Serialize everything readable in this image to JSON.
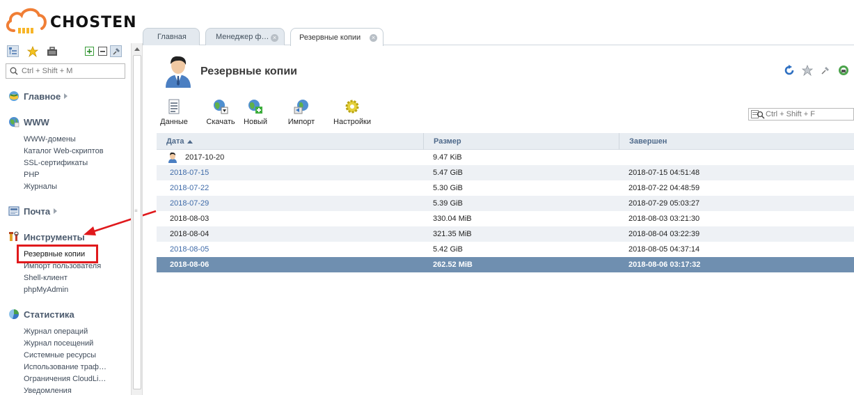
{
  "brand": {
    "name": "CHOSTEN",
    "color": "#f07e35"
  },
  "sidebar": {
    "toolbar_icons": [
      "tree-icon",
      "star-icon",
      "briefcase-icon",
      "expand-all-icon",
      "collapse-all-icon",
      "pin-icon"
    ],
    "search": {
      "placeholder": "Ctrl + Shift + M",
      "value": ""
    },
    "sections": [
      {
        "label": "Главное",
        "icon": "home-globe-icon",
        "has_caret": true,
        "items": []
      },
      {
        "label": "WWW",
        "icon": "www-globe-icon",
        "has_caret": false,
        "items": [
          "WWW-домены",
          "Каталог Web-скриптов",
          "SSL-сертификаты",
          "PHP",
          "Журналы"
        ]
      },
      {
        "label": "Почта",
        "icon": "mail-icon",
        "has_caret": true,
        "items": []
      },
      {
        "label": "Инструменты",
        "icon": "tools-icon",
        "has_caret": false,
        "items": [
          "Резервные копии",
          "Импорт пользователя",
          "Shell-клиент",
          "phpMyAdmin"
        ]
      },
      {
        "label": "Статистика",
        "icon": "stats-icon",
        "has_caret": false,
        "items": [
          "Журнал операций",
          "Журнал посещений",
          "Системные ресурсы",
          "Использование траф…",
          "Ограничения CloudLi…",
          "Уведомления"
        ]
      }
    ],
    "highlighted_item": "Резервные копии"
  },
  "tabs": [
    {
      "label": "Главная",
      "closable": false,
      "active": false
    },
    {
      "label": "Менеджер ф…",
      "closable": true,
      "active": false
    },
    {
      "label": "Резервные копии",
      "closable": true,
      "active": true
    }
  ],
  "main": {
    "title": "Резервные копии",
    "toolbar": [
      {
        "label": "Данные",
        "icon": "data-list-icon"
      },
      {
        "label": "Скачать",
        "icon": "download-globe-icon"
      },
      {
        "label": "Новый",
        "icon": "new-globe-icon"
      },
      {
        "label": "Импорт",
        "icon": "import-icon"
      },
      {
        "label": "Настройки",
        "icon": "settings-gear-icon"
      }
    ],
    "top_right_icons": [
      "refresh-icon",
      "favorite-star-icon",
      "pin-icon",
      "help-globe-icon"
    ],
    "filter": {
      "placeholder": "Ctrl + Shift + F",
      "value": ""
    },
    "table": {
      "columns": [
        {
          "label": "Дата",
          "sorted": "asc"
        },
        {
          "label": "Размер"
        },
        {
          "label": "Завершен"
        }
      ],
      "rows": [
        {
          "date": "2017-10-20",
          "size": "9.47 KiB",
          "finished": "",
          "has_user_icon": true,
          "link": false,
          "selected": false
        },
        {
          "date": "2018-07-15",
          "size": "5.47 GiB",
          "finished": "2018-07-15 04:51:48",
          "link": true,
          "selected": false
        },
        {
          "date": "2018-07-22",
          "size": "5.30 GiB",
          "finished": "2018-07-22 04:48:59",
          "link": true,
          "selected": false
        },
        {
          "date": "2018-07-29",
          "size": "5.39 GiB",
          "finished": "2018-07-29 05:03:27",
          "link": true,
          "selected": false
        },
        {
          "date": "2018-08-03",
          "size": "330.04 MiB",
          "finished": "2018-08-03 03:21:30",
          "link": false,
          "selected": false
        },
        {
          "date": "2018-08-04",
          "size": "321.35 MiB",
          "finished": "2018-08-04 03:22:39",
          "link": false,
          "selected": false
        },
        {
          "date": "2018-08-05",
          "size": "5.42 GiB",
          "finished": "2018-08-05 04:37:14",
          "link": true,
          "selected": false
        },
        {
          "date": "2018-08-06",
          "size": "262.52 MiB",
          "finished": "2018-08-06 03:17:32",
          "link": false,
          "selected": true
        }
      ]
    }
  },
  "colors": {
    "accent_blue": "#4f6a8b",
    "selected_row": "#6f8fb0",
    "annotation_red": "#e0191c"
  }
}
